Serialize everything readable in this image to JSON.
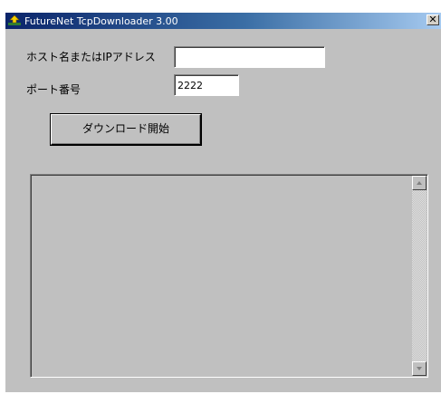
{
  "window": {
    "title": "FutureNet TcpDownloader 3.00",
    "close_glyph": "✕",
    "title_gradient": [
      "#0a246a",
      "#3a6ea5",
      "#a6caf0"
    ],
    "background": "#c0c0c0"
  },
  "form": {
    "host_label": "ホスト名またはIPアドレス",
    "host_value": "",
    "port_label": "ポート番号",
    "port_value": "2222"
  },
  "actions": {
    "download_label": "ダウンロード開始"
  },
  "log": {
    "content": "",
    "scroll_up_icon": "scroll-up-arrow",
    "scroll_down_icon": "scroll-down-arrow"
  }
}
